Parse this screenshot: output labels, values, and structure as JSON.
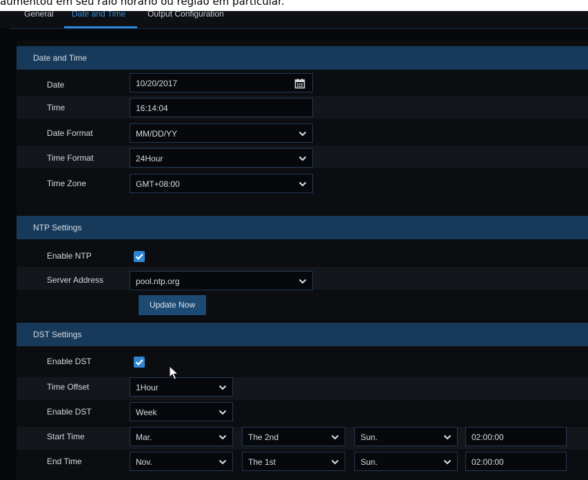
{
  "caption": "aumentou em seu raio horário ou região em particular.",
  "tabs": [
    "General",
    "Date and Time",
    "Output Configuration"
  ],
  "sections": {
    "date_time": "Date and Time",
    "ntp": "NTP Settings",
    "dst": "DST Settings"
  },
  "date_time": {
    "date_label": "Date",
    "date_value": "10/20/2017",
    "time_label": "Time",
    "time_value": "16:14:04",
    "date_format_label": "Date Format",
    "date_format_value": "MM/DD/YY",
    "time_format_label": "Time Format",
    "time_format_value": "24Hour",
    "time_zone_label": "Time Zone",
    "time_zone_value": "GMT+08:00"
  },
  "ntp": {
    "enable_label": "Enable NTP",
    "enable_checked": true,
    "server_label": "Server Address",
    "server_value": "pool.ntp.org",
    "update_button": "Update Now"
  },
  "dst": {
    "enable_label": "Enable DST",
    "enable_checked": true,
    "offset_label": "Time Offset",
    "offset_value": "1Hour",
    "mode_label": "Enable DST",
    "mode_value": "Week",
    "start_label": "Start Time",
    "start_month": "Mar.",
    "start_week": "The 2nd",
    "start_day": "Sun.",
    "start_time": "02:00:00",
    "end_label": "End Time",
    "end_month": "Nov.",
    "end_week": "The 1st",
    "end_day": "Sun.",
    "end_time": "02:00:00"
  },
  "icons": {
    "calendar": "calendar-icon",
    "dropdown": "chevron-down-icon",
    "check": "checkmark-icon",
    "cursor": "mouse-pointer-icon"
  },
  "colors": {
    "background": "#06080c",
    "section_header": "#183a5a",
    "accent": "#2e86d2",
    "active_tab": "#3a8ed6",
    "button": "#1d4a73"
  }
}
